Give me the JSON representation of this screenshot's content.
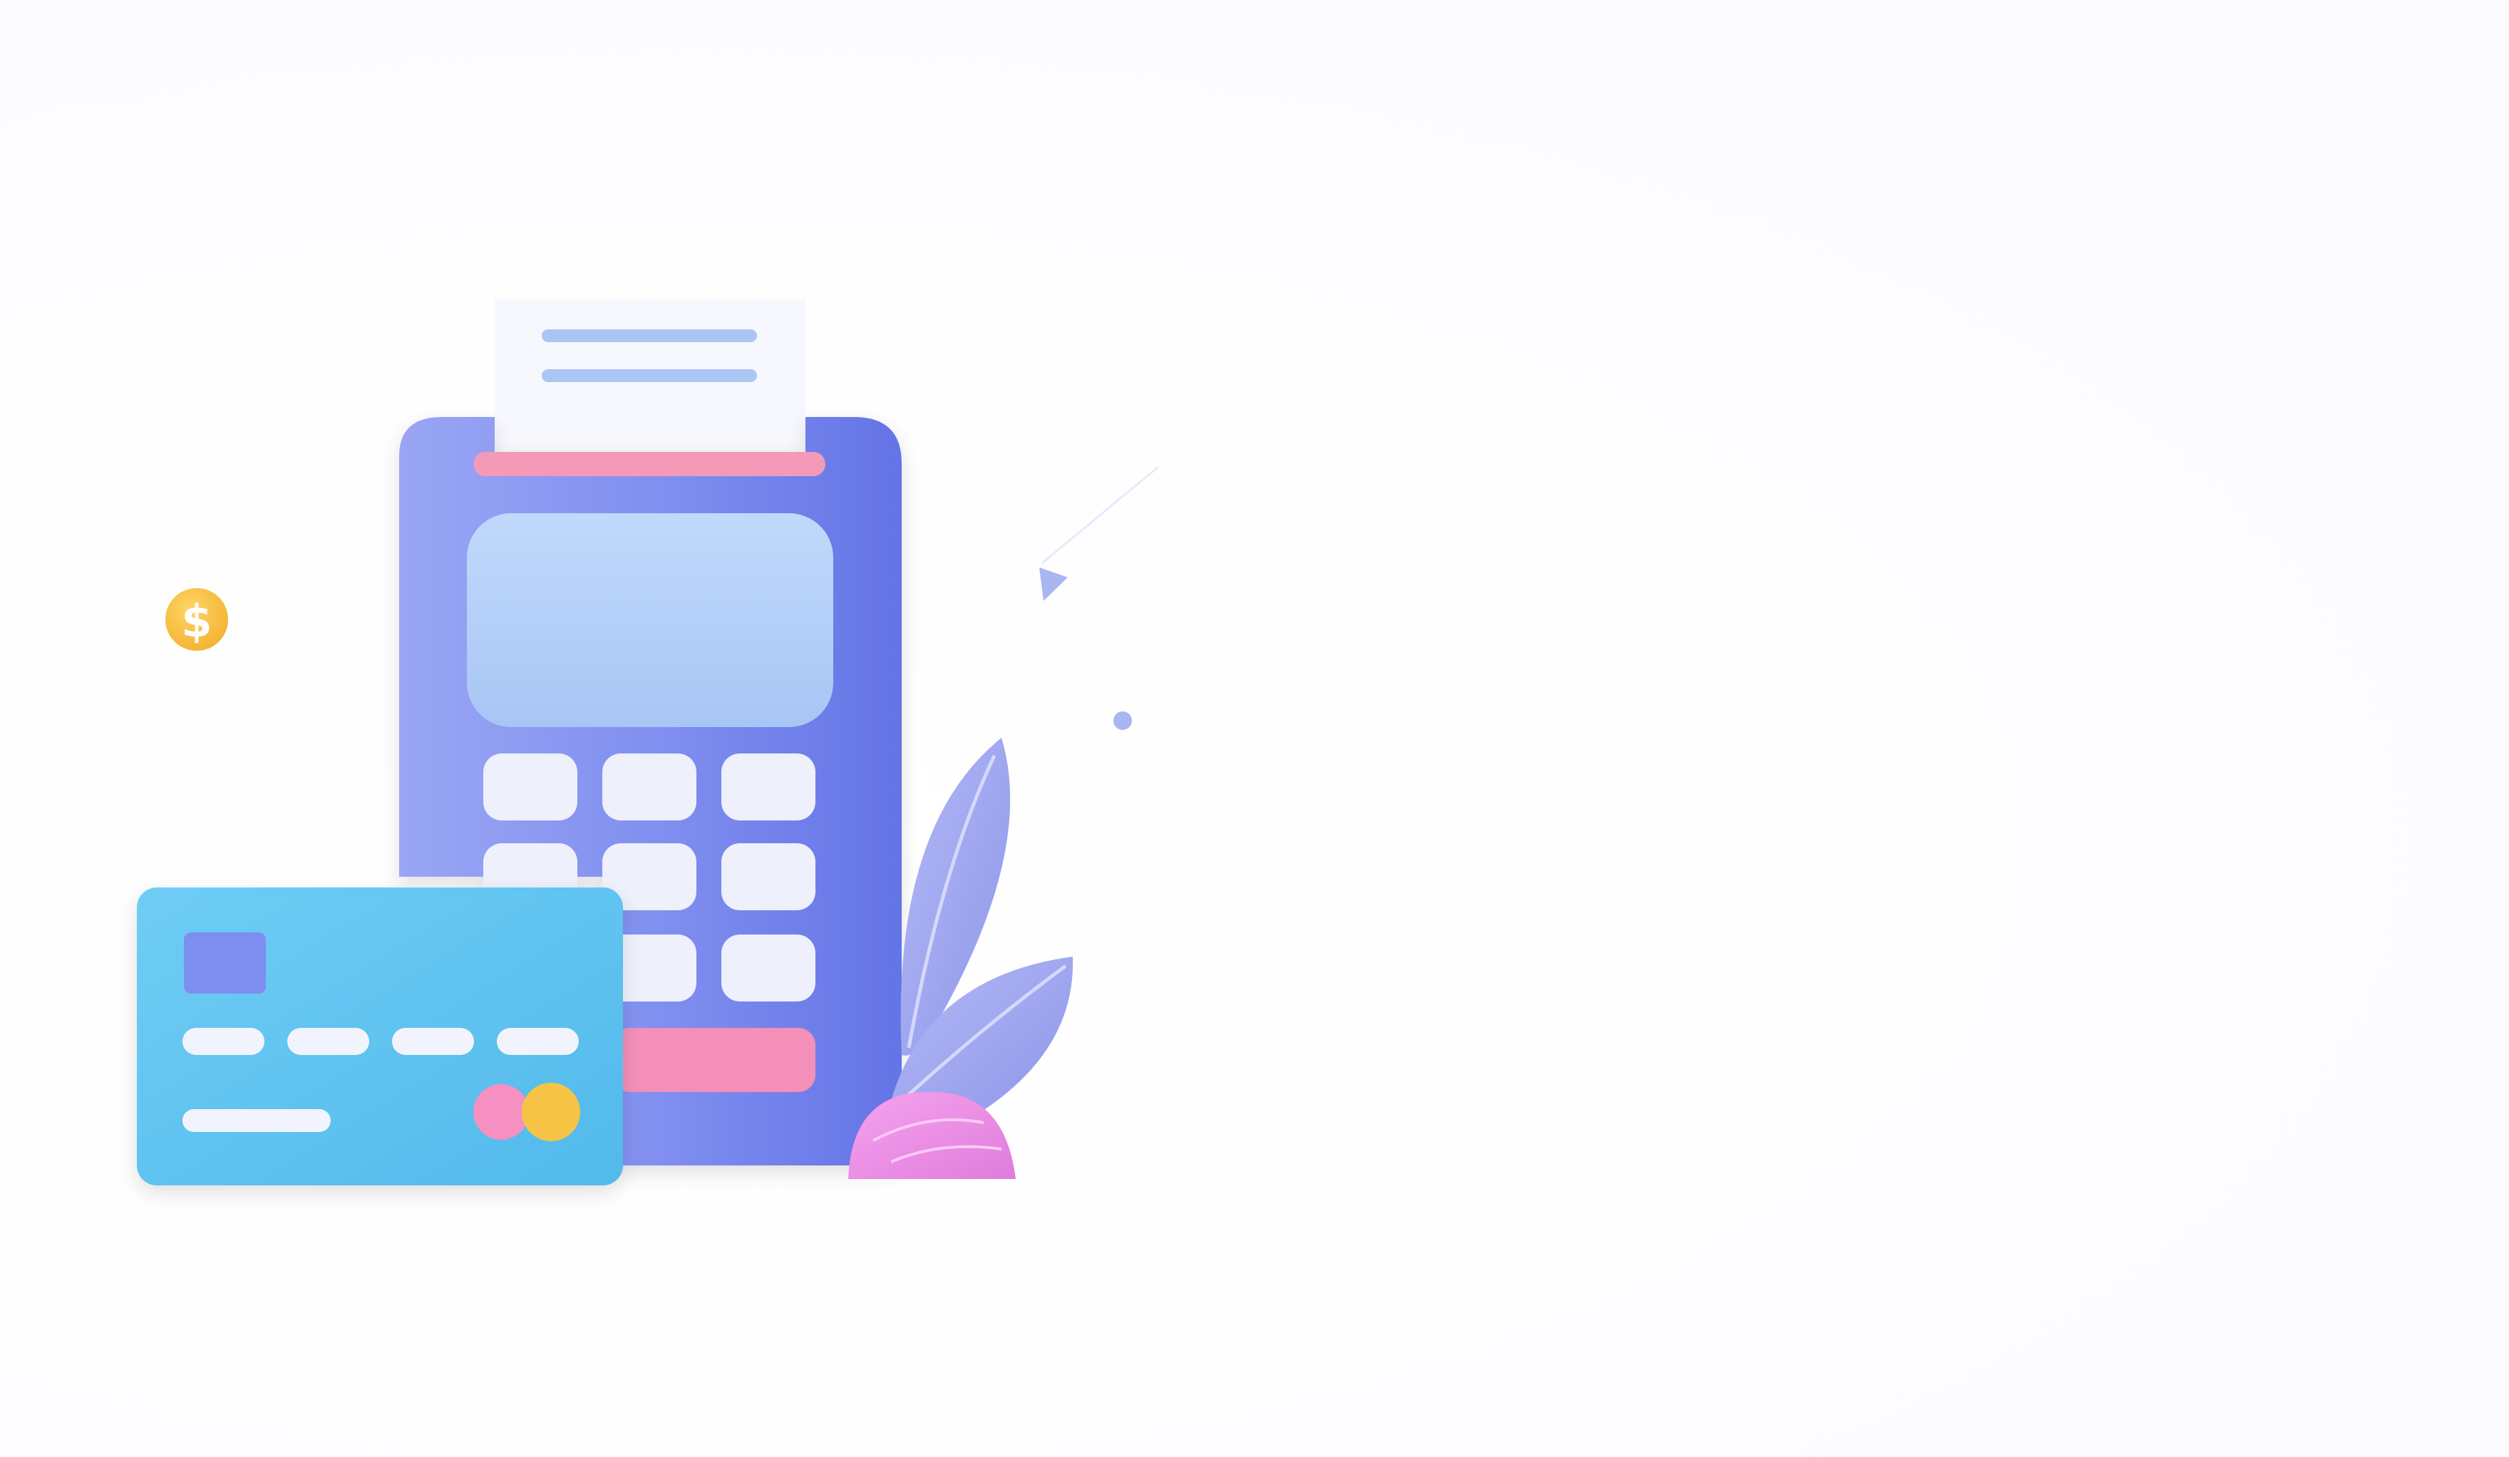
{
  "illustration": {
    "coin_symbol": "$",
    "keypad_rows": 3,
    "keypad_cols": 3,
    "colors": {
      "terminal_body": "#7f8ef0",
      "terminal_body_dark": "#6474e6",
      "terminal_screen": "#b4d1f8",
      "receipt_lines": "#a9c6f5",
      "receipt_slot": "#f49ab8",
      "keys": "#eef0fb",
      "pay_key": "#f38fb9",
      "card": "#5ec3ef",
      "card_chip": "#7e8ef0",
      "card_circle_pink": "#f690c0",
      "card_circle_gold": "#f6c444",
      "coin": "#f6bd3b",
      "leaf": "#9ea6ef",
      "bulb": "#ee8fe6",
      "accent_dot": "#a8b6f2"
    }
  }
}
